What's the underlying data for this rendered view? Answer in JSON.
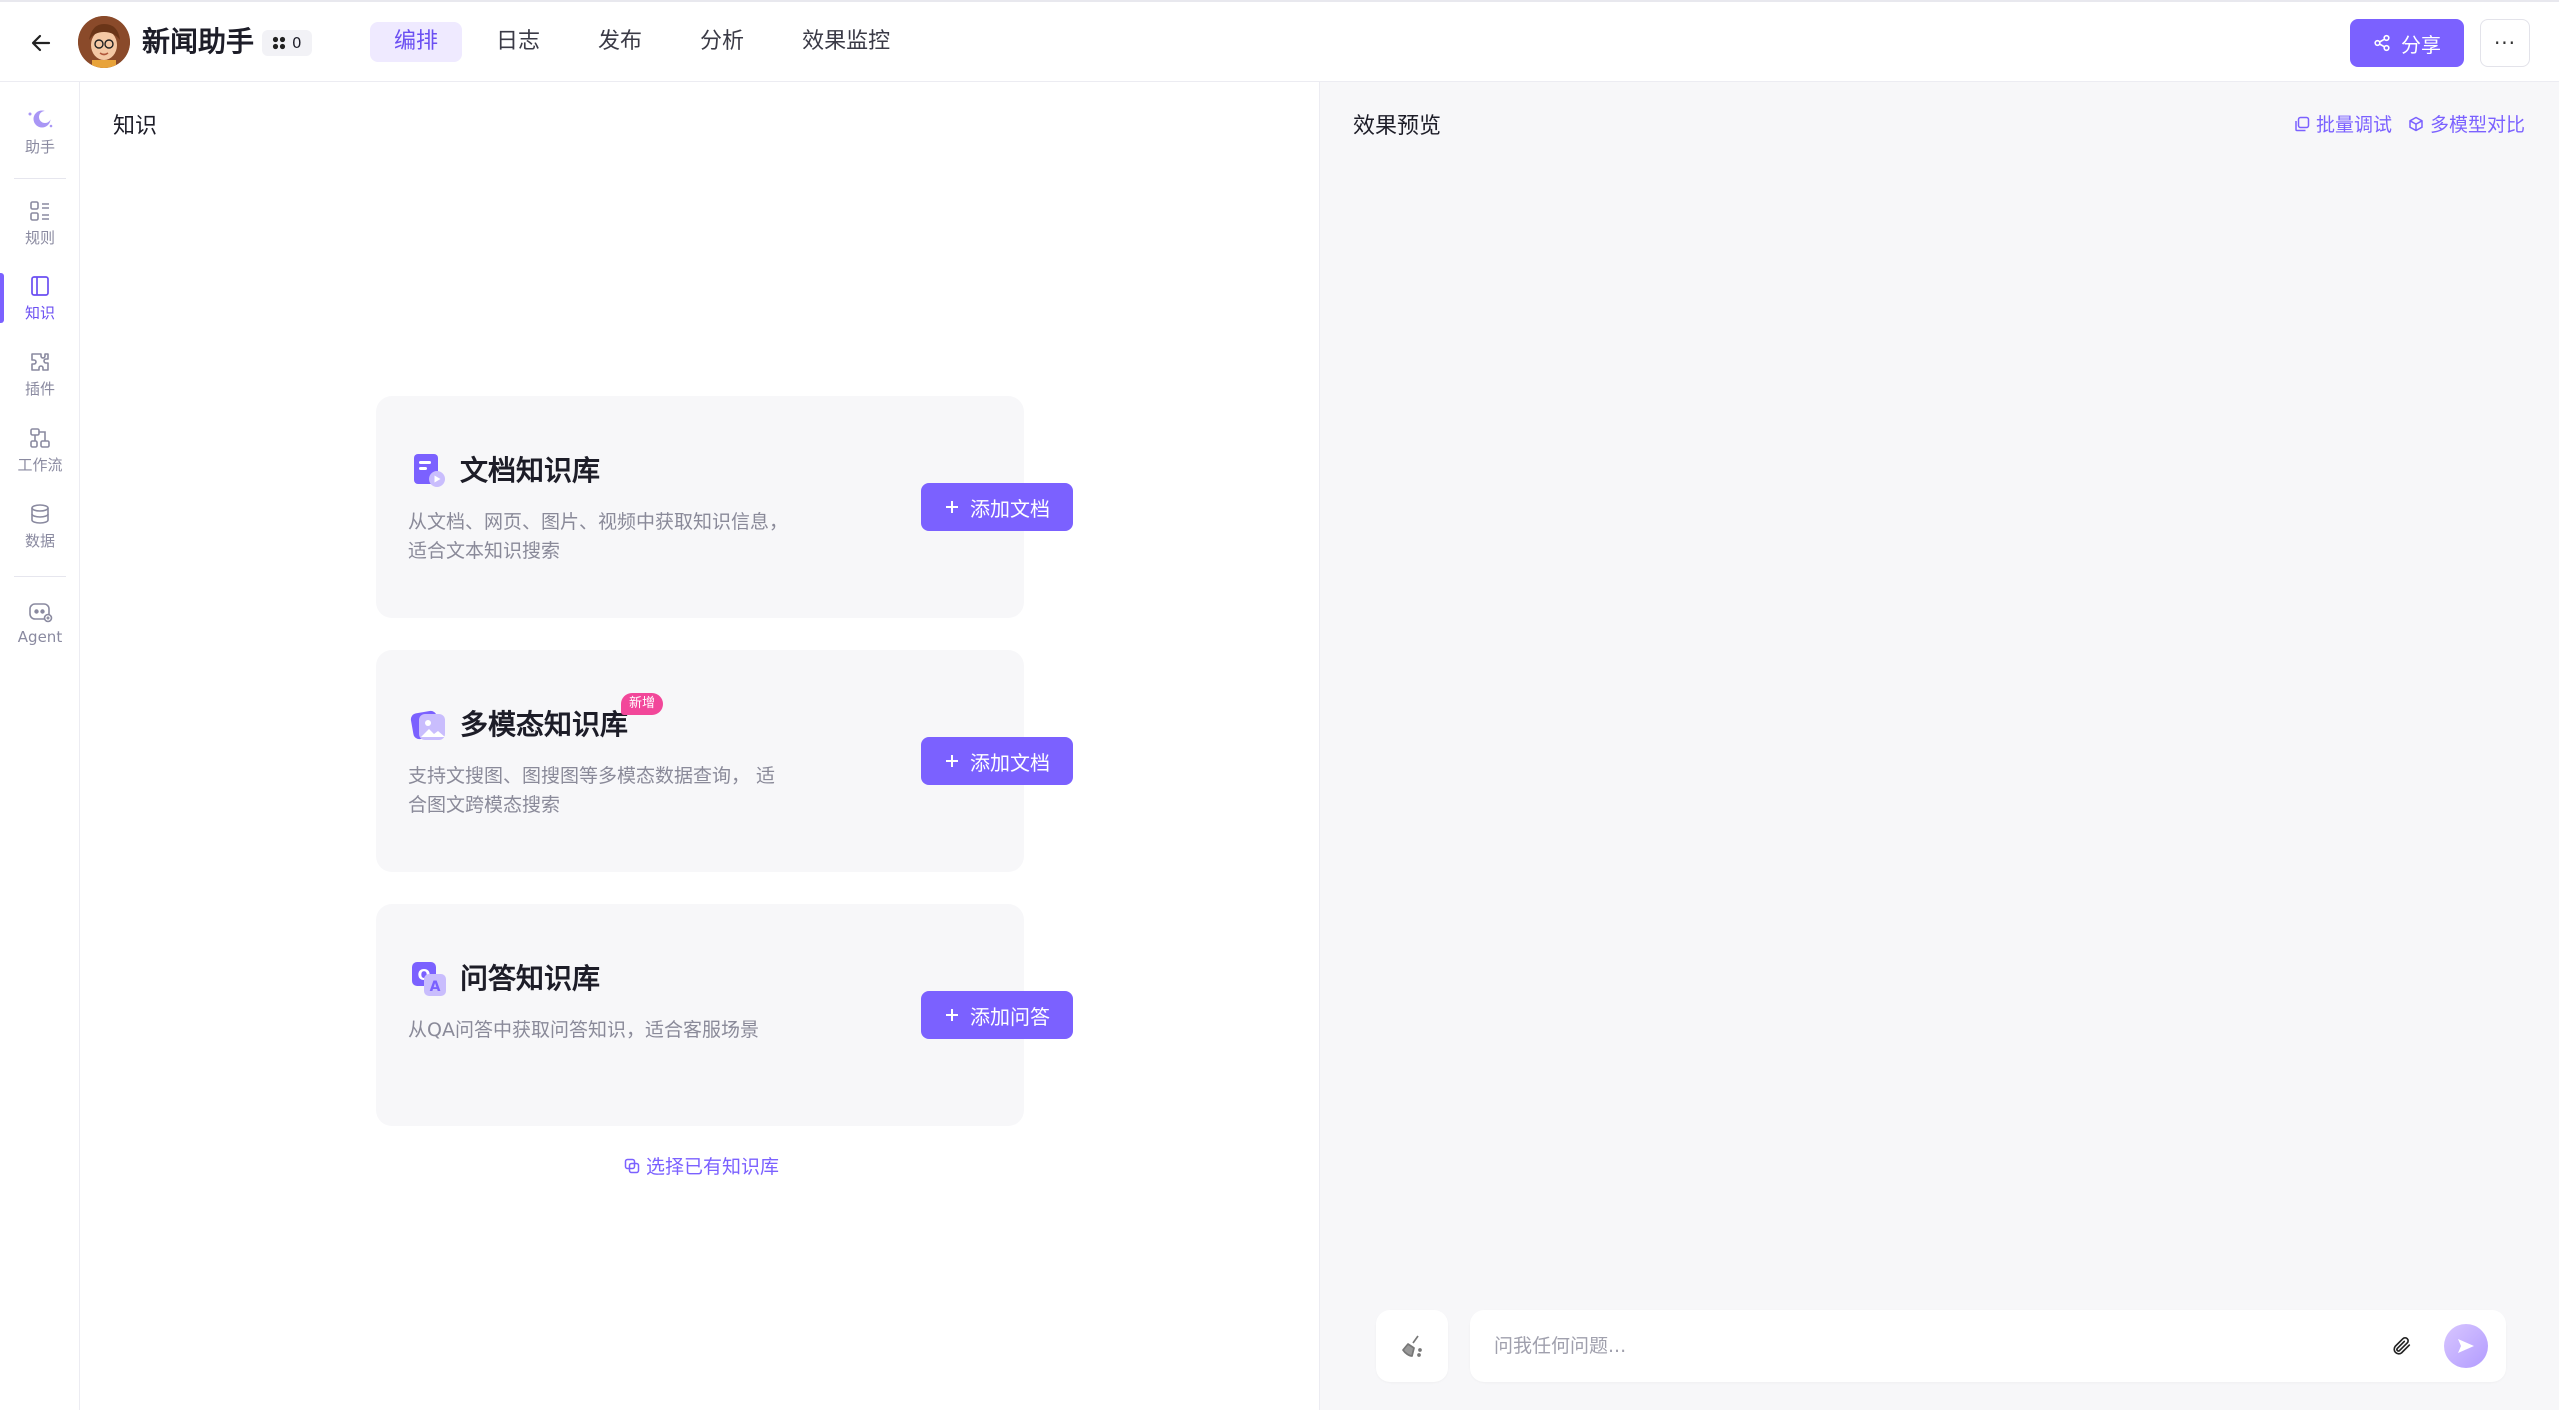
{
  "header": {
    "title": "新闻助手",
    "plugin_count": "0",
    "tabs": [
      {
        "label": "编排",
        "active": true
      },
      {
        "label": "日志",
        "active": false
      },
      {
        "label": "发布",
        "active": false
      },
      {
        "label": "分析",
        "active": false
      },
      {
        "label": "效果监控",
        "active": false
      }
    ],
    "share_label": "分享",
    "more_label": "···"
  },
  "sidebar": {
    "items": [
      {
        "label": "助手",
        "icon": "assistant-icon"
      },
      {
        "label": "规则",
        "icon": "rules-icon"
      },
      {
        "label": "知识",
        "icon": "knowledge-icon",
        "active": true
      },
      {
        "label": "插件",
        "icon": "plugin-icon"
      },
      {
        "label": "工作流",
        "icon": "workflow-icon"
      },
      {
        "label": "数据",
        "icon": "database-icon"
      },
      {
        "label": "Agent",
        "icon": "agent-icon"
      }
    ]
  },
  "knowledge": {
    "title": "知识",
    "cards": [
      {
        "title": "文档知识库",
        "desc": "从文档、网页、图片、视频中获取知识信息， 适合文本知识搜索",
        "button": "添加文档"
      },
      {
        "title": "多模态知识库",
        "badge": "新增",
        "desc": "支持文搜图、图搜图等多模态数据查询， 适合图文跨模态搜索",
        "button": "添加文档"
      },
      {
        "title": "问答知识库",
        "desc": "从QA问答中获取问答知识，适合客服场景",
        "button": "添加问答"
      }
    ],
    "select_existing": "选择已有知识库"
  },
  "preview": {
    "title": "效果预览",
    "batch_debug": "批量调试",
    "multi_model": "多模型对比",
    "input_placeholder": "问我任何问题..."
  },
  "colors": {
    "accent": "#7b61ff",
    "accent_light": "#efeaff",
    "badge": "#f2479a",
    "panel_bg": "#f7f7f9"
  }
}
